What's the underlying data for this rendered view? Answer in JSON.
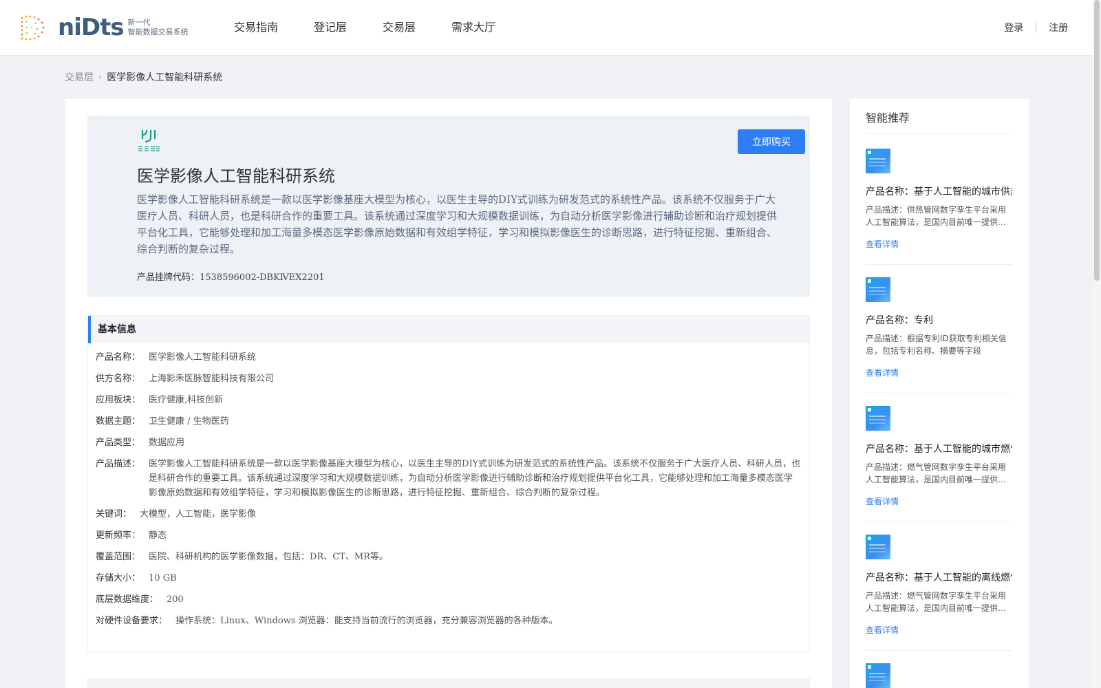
{
  "brand": {
    "wordmark": "niDts",
    "sub_line1": "新一代",
    "sub_line2": "智能数据交易系统"
  },
  "nav": [
    "交易指南",
    "登记层",
    "交易层",
    "需求大厅"
  ],
  "auth": {
    "login": "登录",
    "register": "注册"
  },
  "breadcrumb": {
    "parent": "交易层",
    "current": "医学影像人工智能科研系统"
  },
  "hero": {
    "title": "医学影像人工智能科研系统",
    "description": "医学影像人工智能科研系统是一款以医学影像基座大模型为核心，以医生主导的DIY式训练为研发范式的系统性产品。该系统不仅服务于广大医疗人员、科研人员，也是科研合作的重要工具。该系统通过深度学习和大规模数据训练，为自动分析医学影像进行辅助诊断和治疗规划提供平台化工具，它能够处理和加工海量多模态医学影像原始数据和有效组学特征，学习和模拟影像医生的诊断思路，进行特征挖掘、重新组合、综合判断的复杂过程。",
    "code_label": "产品挂牌代码：",
    "code_value": "1538596002-DBKⅣEX2201",
    "buy_button": "立即购买"
  },
  "basic_info": {
    "heading": "基本信息",
    "rows": [
      {
        "k": "产品名称：",
        "v": "医学影像人工智能科研系统"
      },
      {
        "k": "供方名称：",
        "v": "上海影禾医脉智能科技有限公司"
      },
      {
        "k": "应用板块：",
        "v": "医疗健康,科技创新"
      },
      {
        "k": "数据主题：",
        "v": "卫生健康 / 生物医药"
      },
      {
        "k": "产品类型：",
        "v": "数据应用"
      },
      {
        "k": "产品描述：",
        "v": "医学影像人工智能科研系统是一款以医学影像基座大模型为核心，以医生主导的DIY式训练为研发范式的系统性产品。该系统不仅服务于广大医疗人员、科研人员，也是科研合作的重要工具。该系统通过深度学习和大规模数据训练，为自动分析医学影像进行辅助诊断和治疗规划提供平台化工具，它能够处理和加工海量多模态医学影像原始数据和有效组学特征，学习和模拟影像医生的诊断思路，进行特征挖掘、重新组合、综合判断的复杂过程。"
      },
      {
        "k": "关键词：",
        "v": "大模型，人工智能，医学影像"
      },
      {
        "k": "更新频率：",
        "v": "静态"
      },
      {
        "k": "覆盖范围：",
        "v": "医院、科研机构的医学影像数据，包括：DR、CT、MR等。"
      },
      {
        "k": "存储大小：",
        "v": "10 GB"
      },
      {
        "k": "底层数据维度：",
        "v": "200"
      },
      {
        "k": "对硬件设备要求：",
        "v": "操作系统：Linux、Windows 浏览器：能支持当前流行的浏览器，充分兼容浏览器的各种版本。"
      }
    ]
  },
  "sidebar": {
    "title": "智能推荐",
    "items": [
      {
        "name": "产品名称：基于人工智能的城市供热管网数字孪生平台",
        "desc": "产品描述：供热管网数字孪生平台采用人工智能算法，是国内目前唯一提供城市供热管网全流程仿真的平台",
        "link": "查看详情"
      },
      {
        "name": "产品名称：专利",
        "desc": "产品描述：根据专利ID获取专利相关信息，包括专利名称、摘要等字段",
        "link": "查看详情"
      },
      {
        "name": "产品名称：基于人工智能的城市燃气管网数字孪生平台",
        "desc": "产品描述：燃气管网数字孪生平台采用人工智能算法，是国内目前唯一提供城市燃气管网全流程仿真的平台",
        "link": "查看详情"
      },
      {
        "name": "产品名称：基于人工智能的离线燃气管网仿真系统",
        "desc": "产品描述：燃气管网数字孪生平台采用人工智能算法，是国内目前唯一提供离线燃气管网仿真的平台",
        "link": "查看详情"
      }
    ]
  }
}
